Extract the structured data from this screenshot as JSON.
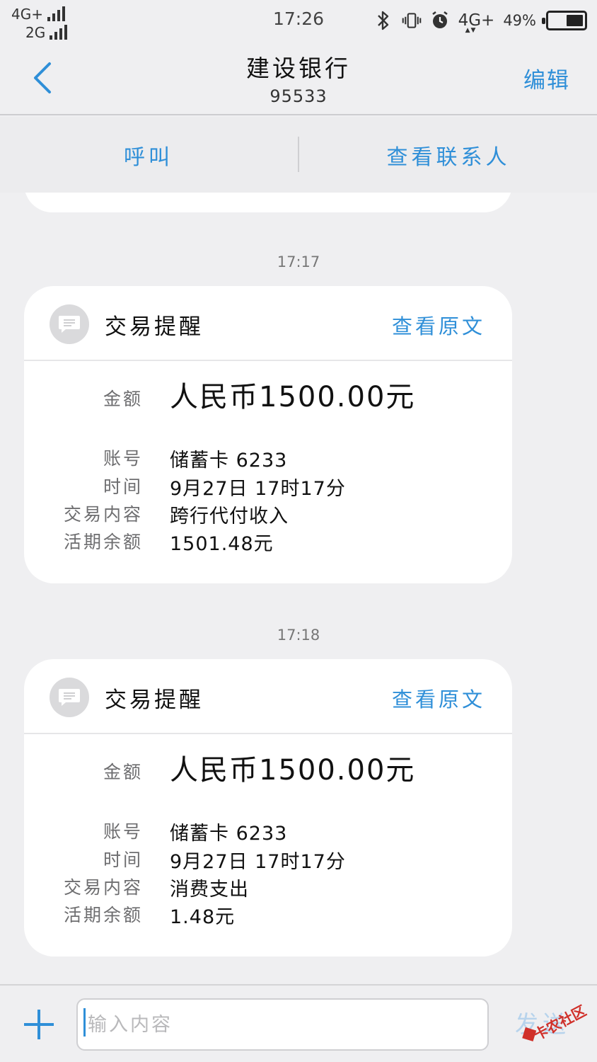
{
  "status_bar": {
    "network_1": "4G+",
    "network_2": "2G",
    "time": "17:26",
    "network_right": "4G+",
    "battery_percent": "49%",
    "battery_level": 0.49
  },
  "header": {
    "title": "建设银行",
    "number": "95533",
    "edit_label": "编辑"
  },
  "actions": {
    "call_label": "呼叫",
    "view_contact_label": "查看联系人"
  },
  "messages": [
    {
      "timestamp": "17:17",
      "title": "交易提醒",
      "view_original_label": "查看原文",
      "fields": [
        {
          "label": "金额",
          "value": "人民币1500.00元"
        },
        {
          "label": "账号",
          "value": "储蓄卡 6233"
        },
        {
          "label": "时间",
          "value": "9月27日 17时17分"
        },
        {
          "label": "交易内容",
          "value": "跨行代付收入"
        },
        {
          "label": "活期余额",
          "value": "1501.48元"
        }
      ]
    },
    {
      "timestamp": "17:18",
      "title": "交易提醒",
      "view_original_label": "查看原文",
      "fields": [
        {
          "label": "金额",
          "value": "人民币1500.00元"
        },
        {
          "label": "账号",
          "value": "储蓄卡 6233"
        },
        {
          "label": "时间",
          "value": "9月27日 17时17分"
        },
        {
          "label": "交易内容",
          "value": "消费支出"
        },
        {
          "label": "活期余额",
          "value": "1.48元"
        }
      ]
    }
  ],
  "input_bar": {
    "placeholder": "输入内容",
    "send_label": "发送"
  },
  "watermark": {
    "text": "卡农社区"
  }
}
